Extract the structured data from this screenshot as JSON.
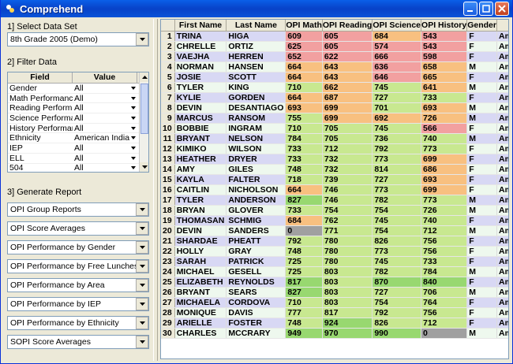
{
  "window": {
    "title": "Comprehend"
  },
  "left": {
    "section1": "1] Select Data Set",
    "dataset": "8th Grade 2005 (Demo)",
    "section2": "2] Filter Data",
    "filter_headers": {
      "field": "Field",
      "value": "Value"
    },
    "filters": [
      {
        "field": "Gender",
        "value": "All"
      },
      {
        "field": "Math Performance",
        "value": "All"
      },
      {
        "field": "Reading Performance",
        "value": "All"
      },
      {
        "field": "Science Performance",
        "value": "All"
      },
      {
        "field": "History Performance",
        "value": "All"
      },
      {
        "field": "Ethnicity",
        "value": "American Indian"
      },
      {
        "field": "IEP",
        "value": "All"
      },
      {
        "field": "ELL",
        "value": "All"
      },
      {
        "field": "504",
        "value": "All"
      }
    ],
    "section3": "3] Generate Report",
    "reports": [
      "OPI Group Reports",
      "OPI Score Averages",
      "OPI Performance by Gender",
      "OPI Performance by Free Lunches",
      "OPI Performance by Area",
      "OPI Performance by IEP",
      "OPI Performance by Ethnicity",
      "SOPI Score Averages"
    ]
  },
  "grid": {
    "headers": [
      "First Name",
      "Last Name",
      "OPI Math",
      "OPI Reading",
      "OPI Science",
      "OPI History",
      "Gender",
      "Ethnicity"
    ],
    "colors": {
      "red": "#f2a0a0",
      "orange": "#f8c080",
      "green": "#c8e890",
      "brightgreen": "#98d870",
      "gray": "#a0a0a0"
    },
    "rows": [
      {
        "n": "1",
        "first": "TRINA",
        "last": "HIGA",
        "math": "609",
        "mc": "red",
        "reading": "605",
        "rc": "red",
        "science": "684",
        "sc": "orange",
        "history": "543",
        "hc": "red",
        "gender": "F",
        "eth": "American Indian"
      },
      {
        "n": "2",
        "first": "CHRELLE",
        "last": "ORTIZ",
        "math": "625",
        "mc": "red",
        "reading": "605",
        "rc": "red",
        "science": "574",
        "sc": "red",
        "history": "543",
        "hc": "red",
        "gender": "F",
        "eth": "American Indian"
      },
      {
        "n": "3",
        "first": "VAEJHA",
        "last": "HERREN",
        "math": "652",
        "mc": "red",
        "reading": "622",
        "rc": "red",
        "science": "666",
        "sc": "red",
        "history": "598",
        "hc": "red",
        "gender": "F",
        "eth": "American Indian"
      },
      {
        "n": "4",
        "first": "NORMAN",
        "last": "HANSEN",
        "math": "664",
        "mc": "orange",
        "reading": "643",
        "rc": "orange",
        "science": "636",
        "sc": "red",
        "history": "658",
        "hc": "orange",
        "gender": "M",
        "eth": "American Indian"
      },
      {
        "n": "5",
        "first": "JOSIE",
        "last": "SCOTT",
        "math": "664",
        "mc": "orange",
        "reading": "643",
        "rc": "orange",
        "science": "646",
        "sc": "red",
        "history": "665",
        "hc": "orange",
        "gender": "F",
        "eth": "American Indian"
      },
      {
        "n": "6",
        "first": "TYLER",
        "last": "KING",
        "math": "710",
        "mc": "green",
        "reading": "662",
        "rc": "orange",
        "science": "745",
        "sc": "green",
        "history": "641",
        "hc": "orange",
        "gender": "M",
        "eth": "American Indian"
      },
      {
        "n": "7",
        "first": "KYLIE",
        "last": "GORDEN",
        "math": "664",
        "mc": "orange",
        "reading": "687",
        "rc": "orange",
        "science": "727",
        "sc": "green",
        "history": "733",
        "hc": "green",
        "gender": "F",
        "eth": "American Indian"
      },
      {
        "n": "8",
        "first": "DEVIN",
        "last": "DESANTIAGO",
        "math": "693",
        "mc": "orange",
        "reading": "699",
        "rc": "orange",
        "science": "701",
        "sc": "green",
        "history": "693",
        "hc": "orange",
        "gender": "M",
        "eth": "American Indian"
      },
      {
        "n": "9",
        "first": "MARCUS",
        "last": "RANSOM",
        "math": "755",
        "mc": "green",
        "reading": "699",
        "rc": "orange",
        "science": "692",
        "sc": "orange",
        "history": "726",
        "hc": "orange",
        "gender": "M",
        "eth": "American Indian"
      },
      {
        "n": "10",
        "first": "BOBBIE",
        "last": "INGRAM",
        "math": "710",
        "mc": "green",
        "reading": "705",
        "rc": "green",
        "science": "745",
        "sc": "green",
        "history": "566",
        "hc": "red",
        "gender": "F",
        "eth": "American Indian"
      },
      {
        "n": "11",
        "first": "BRYANT",
        "last": "NELSON",
        "math": "784",
        "mc": "green",
        "reading": "705",
        "rc": "green",
        "science": "736",
        "sc": "green",
        "history": "740",
        "hc": "green",
        "gender": "M",
        "eth": "American Indian"
      },
      {
        "n": "12",
        "first": "KIMIKO",
        "last": "WILSON",
        "math": "733",
        "mc": "green",
        "reading": "712",
        "rc": "green",
        "science": "792",
        "sc": "green",
        "history": "773",
        "hc": "green",
        "gender": "F",
        "eth": "American Indian"
      },
      {
        "n": "13",
        "first": "HEATHER",
        "last": "DRYER",
        "math": "733",
        "mc": "green",
        "reading": "732",
        "rc": "green",
        "science": "773",
        "sc": "green",
        "history": "699",
        "hc": "orange",
        "gender": "F",
        "eth": "American Indian"
      },
      {
        "n": "14",
        "first": "AMY",
        "last": "GILES",
        "math": "748",
        "mc": "green",
        "reading": "732",
        "rc": "green",
        "science": "814",
        "sc": "green",
        "history": "686",
        "hc": "orange",
        "gender": "F",
        "eth": "American Indian"
      },
      {
        "n": "15",
        "first": "KAYLA",
        "last": "FALTER",
        "math": "718",
        "mc": "green",
        "reading": "739",
        "rc": "green",
        "science": "727",
        "sc": "green",
        "history": "693",
        "hc": "orange",
        "gender": "F",
        "eth": "American Indian"
      },
      {
        "n": "16",
        "first": "CAITLIN",
        "last": "NICHOLSON",
        "math": "664",
        "mc": "orange",
        "reading": "746",
        "rc": "green",
        "science": "773",
        "sc": "green",
        "history": "699",
        "hc": "orange",
        "gender": "F",
        "eth": "American Indian"
      },
      {
        "n": "17",
        "first": "TYLER",
        "last": "ANDERSON",
        "math": "827",
        "mc": "brightgreen",
        "reading": "746",
        "rc": "green",
        "science": "782",
        "sc": "green",
        "history": "773",
        "hc": "green",
        "gender": "M",
        "eth": "American Indian"
      },
      {
        "n": "18",
        "first": "BRYAN",
        "last": "GLOVER",
        "math": "733",
        "mc": "green",
        "reading": "754",
        "rc": "green",
        "science": "754",
        "sc": "green",
        "history": "726",
        "hc": "green",
        "gender": "M",
        "eth": "American Indian"
      },
      {
        "n": "19",
        "first": "THOMASAN",
        "last": "SCHMIG",
        "math": "684",
        "mc": "orange",
        "reading": "762",
        "rc": "green",
        "science": "745",
        "sc": "green",
        "history": "740",
        "hc": "green",
        "gender": "F",
        "eth": "American Indian"
      },
      {
        "n": "20",
        "first": "DEVIN",
        "last": "SANDERS",
        "math": "0",
        "mc": "gray",
        "reading": "771",
        "rc": "green",
        "science": "754",
        "sc": "green",
        "history": "712",
        "hc": "green",
        "gender": "M",
        "eth": "American Indian"
      },
      {
        "n": "21",
        "first": "SHARDAE",
        "last": "PHEATT",
        "math": "792",
        "mc": "green",
        "reading": "780",
        "rc": "green",
        "science": "826",
        "sc": "green",
        "history": "756",
        "hc": "green",
        "gender": "F",
        "eth": "American Indian"
      },
      {
        "n": "22",
        "first": "HOLLY",
        "last": "GRAY",
        "math": "748",
        "mc": "green",
        "reading": "780",
        "rc": "green",
        "science": "773",
        "sc": "green",
        "history": "756",
        "hc": "green",
        "gender": "F",
        "eth": "American Indian"
      },
      {
        "n": "23",
        "first": "SARAH",
        "last": "PATRICK",
        "math": "725",
        "mc": "green",
        "reading": "780",
        "rc": "green",
        "science": "745",
        "sc": "green",
        "history": "733",
        "hc": "green",
        "gender": "F",
        "eth": "American Indian"
      },
      {
        "n": "24",
        "first": "MICHAEL",
        "last": "GESELL",
        "math": "725",
        "mc": "green",
        "reading": "803",
        "rc": "green",
        "science": "782",
        "sc": "green",
        "history": "784",
        "hc": "green",
        "gender": "M",
        "eth": "American Indian"
      },
      {
        "n": "25",
        "first": "ELIZABETH",
        "last": "REYNOLDS",
        "math": "817",
        "mc": "brightgreen",
        "reading": "803",
        "rc": "green",
        "science": "870",
        "sc": "brightgreen",
        "history": "840",
        "hc": "brightgreen",
        "gender": "F",
        "eth": "American Indian"
      },
      {
        "n": "26",
        "first": "BRYANT",
        "last": "SEARS",
        "math": "827",
        "mc": "brightgreen",
        "reading": "803",
        "rc": "green",
        "science": "727",
        "sc": "green",
        "history": "706",
        "hc": "green",
        "gender": "M",
        "eth": "American Indian"
      },
      {
        "n": "27",
        "first": "MICHAELA",
        "last": "CORDOVA",
        "math": "710",
        "mc": "green",
        "reading": "803",
        "rc": "green",
        "science": "754",
        "sc": "green",
        "history": "764",
        "hc": "green",
        "gender": "F",
        "eth": "American Indian"
      },
      {
        "n": "28",
        "first": "MONIQUE",
        "last": "DAVIS",
        "math": "777",
        "mc": "green",
        "reading": "817",
        "rc": "green",
        "science": "792",
        "sc": "green",
        "history": "756",
        "hc": "green",
        "gender": "F",
        "eth": "American Indian"
      },
      {
        "n": "29",
        "first": "ARIELLE",
        "last": "FOSTER",
        "math": "748",
        "mc": "green",
        "reading": "924",
        "rc": "brightgreen",
        "science": "826",
        "sc": "green",
        "history": "712",
        "hc": "green",
        "gender": "F",
        "eth": "American Indian"
      },
      {
        "n": "30",
        "first": "CHARLES",
        "last": "MCCRARY",
        "math": "949",
        "mc": "brightgreen",
        "reading": "970",
        "rc": "brightgreen",
        "science": "990",
        "sc": "brightgreen",
        "history": "0",
        "hc": "gray",
        "gender": "M",
        "eth": "American Indian"
      }
    ]
  }
}
